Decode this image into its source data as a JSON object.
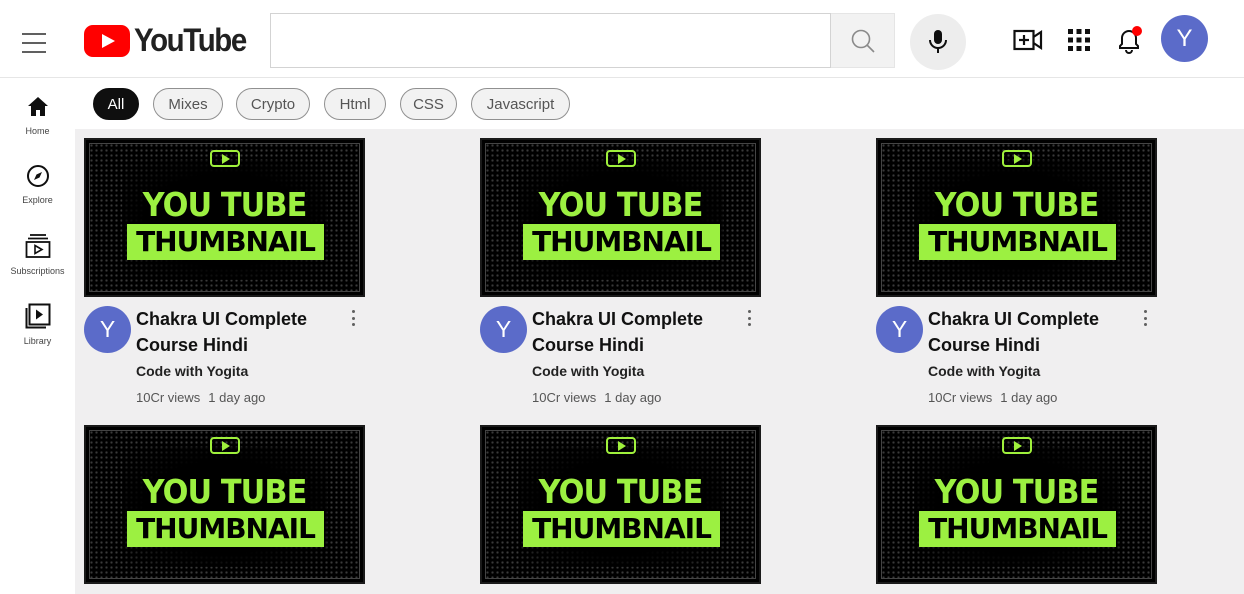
{
  "header": {
    "logo_text": "YouTube",
    "search_placeholder": "",
    "avatar_letter": "Y",
    "notification_dot_color": "#ff0000",
    "icons": [
      "menu-icon",
      "search-icon",
      "mic-icon",
      "create-video-icon",
      "apps-grid-icon",
      "bell-icon"
    ]
  },
  "sidebar": {
    "items": [
      {
        "label": "Home",
        "icon": "home-icon"
      },
      {
        "label": "Explore",
        "icon": "compass-icon"
      },
      {
        "label": "Subscriptions",
        "icon": "subscriptions-icon"
      },
      {
        "label": "Library",
        "icon": "library-icon"
      }
    ]
  },
  "chips": [
    "All",
    "Mixes",
    "Crypto",
    "Html",
    "CSS",
    "Javascript"
  ],
  "active_chip": "All",
  "thumbnail": {
    "line1": "YOU TUBE",
    "line2": "THUMBNAIL",
    "accent_color": "#9cf041"
  },
  "videos": [
    {
      "avatar": "Y",
      "title": "Chakra UI Complete Course Hindi",
      "channel": "Code with Yogita",
      "views": "10Cr views",
      "age": "1 day ago"
    },
    {
      "avatar": "Y",
      "title": "Chakra UI Complete Course Hindi",
      "channel": "Code with Yogita",
      "views": "10Cr views",
      "age": "1 day ago"
    },
    {
      "avatar": "Y",
      "title": "Chakra UI Complete Course Hindi",
      "channel": "Code with Yogita",
      "views": "10Cr views",
      "age": "1 day ago"
    }
  ],
  "colors": {
    "brand_red": "#ff0000",
    "avatar_bg": "#5b6bc9",
    "grid_bg": "#f0eff0"
  }
}
